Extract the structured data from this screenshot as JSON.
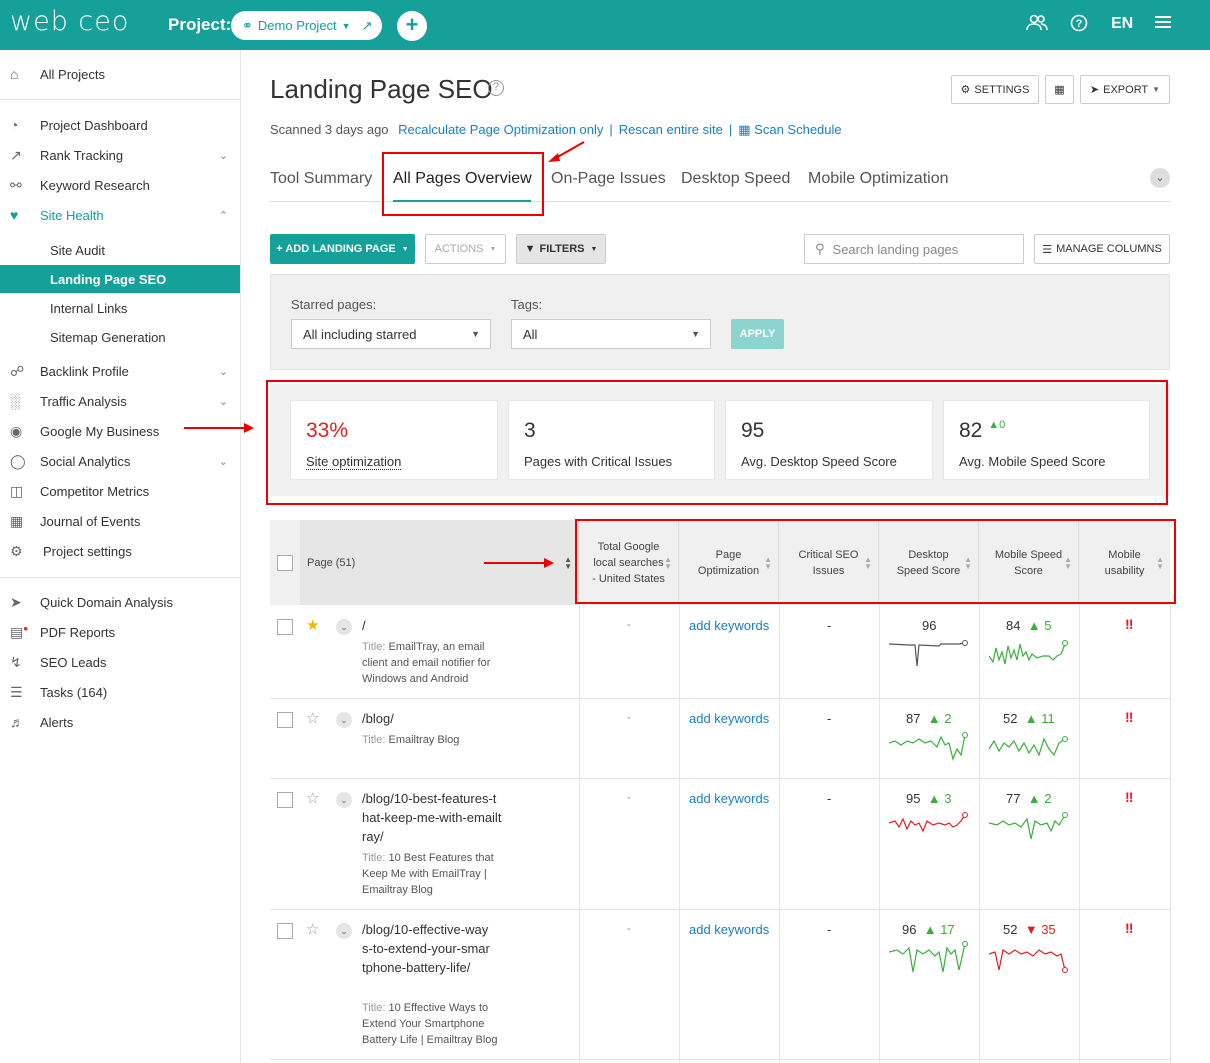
{
  "topbar": {
    "logo": "web ceo",
    "project_label": "Project:",
    "project_name": "Demo Project",
    "add_icon": "plus-icon",
    "lang": "EN",
    "icons": [
      "users-icon",
      "help-icon",
      "menu-icon"
    ]
  },
  "sidebar": {
    "all_projects": "All Projects",
    "items": [
      {
        "label": "Project Dashboard",
        "icon": "dashboard-icon"
      },
      {
        "label": "Rank Tracking",
        "icon": "chart-icon"
      },
      {
        "label": "Keyword Research",
        "icon": "key-icon"
      },
      {
        "label": "Site Health",
        "icon": "heartbeat-icon"
      }
    ],
    "sub_items": [
      "Site Audit",
      "Landing Page SEO",
      "Internal Links",
      "Sitemap Generation"
    ],
    "items2": [
      {
        "label": "Backlink Profile",
        "icon": "link-icon"
      },
      {
        "label": "Traffic Analysis",
        "icon": "bars-icon"
      },
      {
        "label": "Google My Business",
        "icon": "pin-icon"
      },
      {
        "label": "Social Analytics",
        "icon": "chat-icon"
      },
      {
        "label": "Competitor Metrics",
        "icon": "binoculars-icon"
      },
      {
        "label": "Journal of Events",
        "icon": "calendar-icon"
      },
      {
        "label": "Project settings",
        "icon": "gear-icon"
      }
    ],
    "items3": [
      {
        "label": "Quick Domain Analysis",
        "icon": "rocket-icon"
      },
      {
        "label": "PDF Reports",
        "icon": "pdf-icon"
      },
      {
        "label": "SEO Leads",
        "icon": "bolt-icon"
      },
      {
        "label": "Tasks (164)",
        "icon": "tasks-icon"
      },
      {
        "label": "Alerts",
        "icon": "bell-icon"
      }
    ]
  },
  "header": {
    "title": "Landing Page SEO",
    "settings": "SETTINGS",
    "export": "EXPORT"
  },
  "scan": {
    "scanned": "Scanned 3 days ago",
    "recalc": "Recalculate Page Optimization only",
    "rescan": "Rescan entire site",
    "schedule": "Scan Schedule"
  },
  "tabs": [
    "Tool Summary",
    "All Pages Overview",
    "On-Page Issues",
    "Desktop Speed",
    "Mobile Optimization"
  ],
  "toolbar": {
    "add": "+ ADD LANDING PAGE",
    "actions": "ACTIONS",
    "filters": "FILTERS",
    "search_placeholder": "Search landing pages",
    "manage": "MANAGE COLUMNS"
  },
  "filters": {
    "starred_label": "Starred pages:",
    "starred_value": "All including starred",
    "tags_label": "Tags:",
    "tags_value": "All",
    "apply": "APPLY"
  },
  "stats": [
    {
      "value": "33%",
      "label": "Site optimization"
    },
    {
      "value": "3",
      "label": "Pages with Critical Issues"
    },
    {
      "value": "95",
      "label": "Avg. Desktop Speed Score"
    },
    {
      "value": "82",
      "label": "Avg. Mobile Speed Score",
      "delta": "0"
    }
  ],
  "columns": {
    "page": "Page (51)",
    "searches": "Total Google local searches - United States",
    "optimization": "Page Optimization",
    "critical": "Critical SEO Issues",
    "desktop": "Desktop Speed Score",
    "mobile": "Mobile Speed Score",
    "usability": "Mobile usability"
  },
  "rows": [
    {
      "path": "/",
      "title_label": "Title:",
      "title": "EmailTray, an email client and email notifier for Windows and Android",
      "starred": true,
      "searches": "-",
      "opt": "add keywords",
      "critical": "-",
      "desktop": "96",
      "desktop_delta": "",
      "mobile": "84",
      "mobile_delta": "5",
      "mobile_dir": "up"
    },
    {
      "path": "/blog/",
      "title_label": "Title:",
      "title": "Emailtray Blog",
      "starred": false,
      "searches": "-",
      "opt": "add keywords",
      "critical": "-",
      "desktop": "87",
      "desktop_delta": "2",
      "mobile": "52",
      "mobile_delta": "11",
      "mobile_dir": "up"
    },
    {
      "path": "/blog/10-best-features-that-keep-me-with-emailtray/",
      "title_label": "Title:",
      "title": "10 Best Features that Keep Me with EmailTray | Emailtray Blog",
      "starred": false,
      "searches": "-",
      "opt": "add keywords",
      "critical": "-",
      "desktop": "95",
      "desktop_delta": "3",
      "mobile": "77",
      "mobile_delta": "2",
      "mobile_dir": "up"
    },
    {
      "path": "/blog/10-effective-ways-to-extend-your-smartphone-battery-life/",
      "title_label": "Title:",
      "title": "10 Effective Ways to Extend Your Smartphone Battery Life | Emailtray Blog",
      "starred": false,
      "searches": "-",
      "opt": "add keywords",
      "critical": "-",
      "desktop": "96",
      "desktop_delta": "17",
      "mobile": "52",
      "mobile_delta": "35",
      "mobile_dir": "down"
    }
  ],
  "colors": {
    "brand": "#16a09a",
    "link": "#1a7fc1",
    "up": "#3cae3c",
    "down": "#e02020",
    "annotation": "#e00000"
  }
}
